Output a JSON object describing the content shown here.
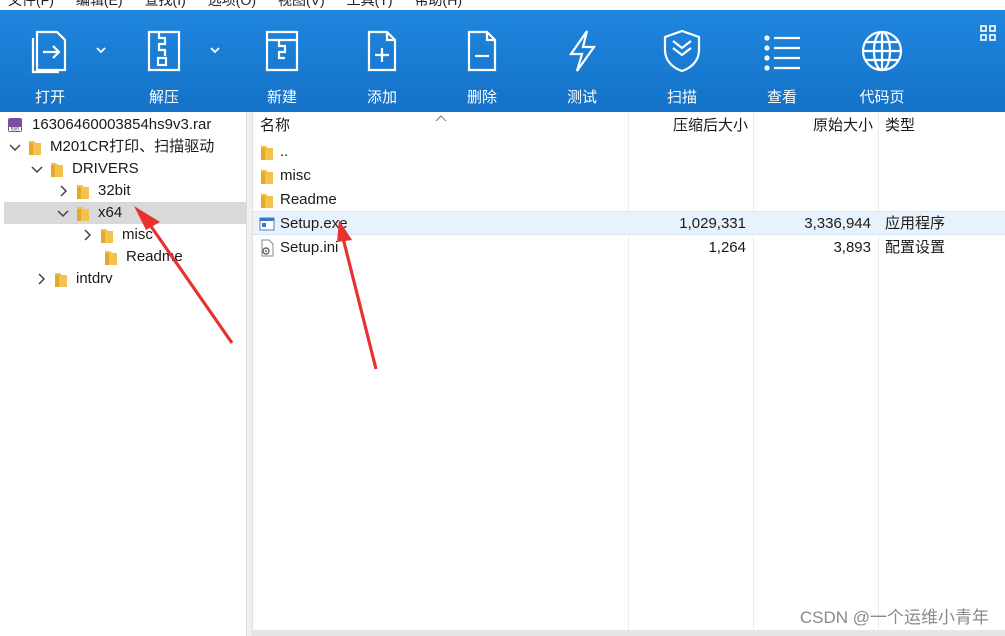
{
  "menu": [
    "文件(F)",
    "编辑(E)",
    "查找(I)",
    "选项(O)",
    "视图(V)",
    "工具(T)",
    "帮助(H)"
  ],
  "toolbar": {
    "open": "打开",
    "extract": "解压",
    "new": "新建",
    "add": "添加",
    "delete": "删除",
    "test": "测试",
    "scan": "扫描",
    "view": "查看",
    "codepage": "代码页"
  },
  "tree": {
    "root": "16306460003854hs9v3.rar",
    "folder1": "M201CR打印、扫描驱动",
    "drivers": "DRIVERS",
    "bit32": "32bit",
    "x64": "x64",
    "misc": "misc",
    "readme": "Readme",
    "intdrv": "intdrv"
  },
  "list": {
    "headers": {
      "name": "名称",
      "packed": "压缩后大小",
      "original": "原始大小",
      "type": "类型"
    },
    "rows": [
      {
        "name": "..",
        "packed": "",
        "original": "",
        "type": ""
      },
      {
        "name": "misc",
        "packed": "",
        "original": "",
        "type": ""
      },
      {
        "name": "Readme",
        "packed": "",
        "original": "",
        "type": ""
      },
      {
        "name": "Setup.exe",
        "packed": "1,029,331",
        "original": "3,336,944",
        "type": "应用程序"
      },
      {
        "name": "Setup.ini",
        "packed": "1,264",
        "original": "3,893",
        "type": "配置设置"
      }
    ]
  },
  "watermark": "CSDN @一个运维小青年",
  "colors": {
    "toolbar": "#1a7bd6",
    "folder": "#f3c24d",
    "arrow": "#e8322f",
    "selected": "#d9d9d9",
    "highlight": "#e8f2fc"
  }
}
